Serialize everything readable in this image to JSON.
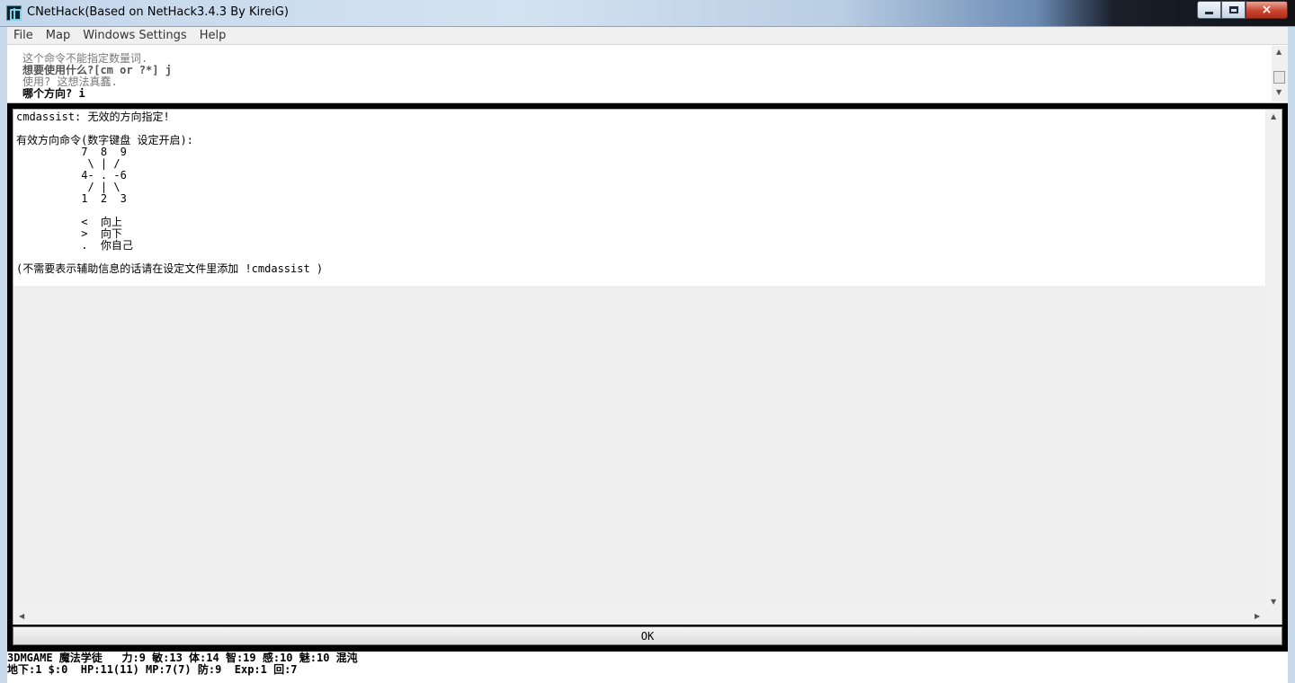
{
  "window": {
    "title": "CNetHack(Based on NetHack3.4.3 By KireiG)",
    "icon": "app-icon",
    "controls": {
      "minimize": "minimize-icon",
      "maximize": "maximize-icon",
      "close": "×"
    }
  },
  "menubar": {
    "items": [
      "File",
      "Map",
      "Windows Settings",
      "Help"
    ]
  },
  "messages": {
    "lines": [
      "这个命令不能指定数量词.",
      "想要使用什么?[cm or ?*] j",
      "使用? 这想法真蠢.",
      "哪个方向? i"
    ]
  },
  "textwindow": {
    "lines": [
      "cmdassist: 无效的方向指定!",
      "",
      "有效方向命令(数字键盘 设定开启):",
      "          7  8  9",
      "           \\ | /",
      "          4- . -6",
      "           / | \\",
      "          1  2  3",
      "",
      "          <  向上",
      "          >  向下",
      "          .  你自己",
      "",
      "(不需要表示辅助信息的话请在设定文件里添加 !cmdassist )"
    ],
    "ok_label": "OK"
  },
  "status": {
    "line1": "3DMGAME 魔法学徒   力:9 敏:13 体:14 智:19 感:10 魅:10 混沌",
    "line2": "地下:1 $:0  HP:11(11) MP:7(7) 防:9  Exp:1 回:7"
  },
  "colors": {
    "titlebar_start": "#c3d6ea",
    "frame": "#c9d9ec",
    "window_bg": "#000000",
    "pane_bg": "#efefef",
    "close_button": "#c7452f"
  }
}
